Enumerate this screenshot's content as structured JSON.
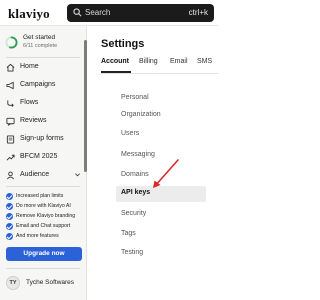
{
  "topbar": {
    "logo": "klaviyo",
    "search_placeholder": "Search",
    "search_shortcut": "ctrl+k"
  },
  "sidebar": {
    "getting_started": {
      "title": "Get started",
      "subtitle": "6/11 complete",
      "progress": 0.545
    },
    "items": [
      {
        "label": "Home",
        "icon": "home-icon"
      },
      {
        "label": "Campaigns",
        "icon": "campaigns-icon"
      },
      {
        "label": "Flows",
        "icon": "flows-icon"
      },
      {
        "label": "Reviews",
        "icon": "reviews-icon"
      },
      {
        "label": "Sign-up forms",
        "icon": "signup-forms-icon"
      },
      {
        "label": "BFCM 2025",
        "icon": "trending-icon"
      },
      {
        "label": "Audience",
        "icon": "audience-icon"
      }
    ],
    "features": [
      "Increased plan limits",
      "Do more with Klaviyo AI",
      "Remove Klaviyo branding",
      "Email and Chat support",
      "And more features"
    ],
    "upgrade_label": "Upgrade now",
    "account": {
      "initials": "TY",
      "name": "Tyche Softwares"
    }
  },
  "main": {
    "title": "Settings",
    "tabs": [
      {
        "label": "Account",
        "active": true
      },
      {
        "label": "Billing"
      },
      {
        "label": "Email"
      },
      {
        "label": "SMS"
      }
    ],
    "settings_items": [
      {
        "label": "Personal"
      },
      {
        "label": "Organization"
      },
      {
        "label": "Users"
      },
      {
        "label": "Messaging"
      },
      {
        "label": "Domains"
      },
      {
        "label": "API keys",
        "active": true
      },
      {
        "label": "Security"
      },
      {
        "label": "Tags"
      },
      {
        "label": "Testing"
      }
    ]
  },
  "colors": {
    "accent": "#2c62d8",
    "progress": "#2e9e5b",
    "annotation_arrow": "#d92a2a"
  }
}
